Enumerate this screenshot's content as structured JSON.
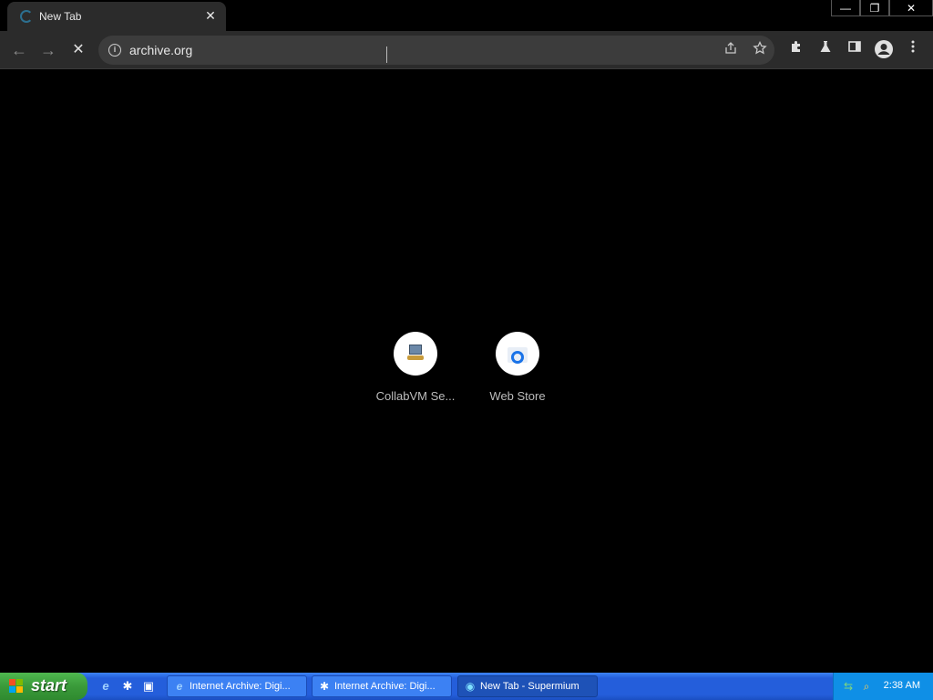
{
  "browser": {
    "tab": {
      "title": "New Tab",
      "close_glyph": "✕"
    },
    "window_controls": {
      "minimize": "—",
      "restore": "❐",
      "close": "✕"
    },
    "toolbar": {
      "back_glyph": "←",
      "forward_glyph": "→",
      "stop_glyph": "✕",
      "url": "archive.org",
      "info_glyph": "i"
    }
  },
  "shortcuts": [
    {
      "label": "CollabVM Se...",
      "icon": "collabvm-icon"
    },
    {
      "label": "Web Store",
      "icon": "web-store-icon"
    }
  ],
  "taskbar": {
    "start_label": "start",
    "buttons": [
      {
        "label": "Internet Archive: Digi...",
        "icon": "ie-icon",
        "active": false
      },
      {
        "label": "Internet Archive: Digi...",
        "icon": "app-icon",
        "active": false
      },
      {
        "label": "New Tab - Supermium",
        "icon": "supermium-icon",
        "active": true
      }
    ],
    "clock": "2:38 AM"
  }
}
